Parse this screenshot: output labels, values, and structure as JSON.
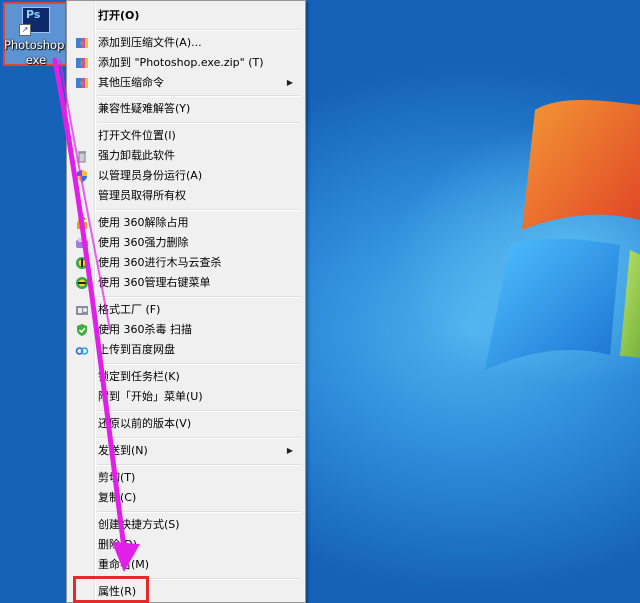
{
  "desktop": {
    "shortcut": {
      "label": "Photoshop.\nexe",
      "icon_text": "Ps"
    }
  },
  "menu": {
    "items": [
      {
        "label": "打开(O)",
        "icon": "none",
        "bold": true
      },
      {
        "label": "添加到压缩文件(A)...",
        "icon": "archive-icon"
      },
      {
        "label": "添加到 \"Photoshop.exe.zip\" (T)",
        "icon": "archive-icon"
      },
      {
        "label": "其他压缩命令",
        "icon": "archive-icon",
        "submenu": true
      },
      {
        "label": "兼容性疑难解答(Y)",
        "icon": "none"
      },
      {
        "label": "打开文件位置(I)",
        "icon": "none"
      },
      {
        "label": "强力卸载此软件",
        "icon": "trash-icon"
      },
      {
        "label": "以管理员身份运行(A)",
        "icon": "shield-icon"
      },
      {
        "label": "管理员取得所有权",
        "icon": "none"
      },
      {
        "label": "使用 360解除占用",
        "icon": "unlock-icon"
      },
      {
        "label": "使用 360强力删除",
        "icon": "shred-icon"
      },
      {
        "label": "使用 360进行木马云查杀",
        "icon": "360-icon"
      },
      {
        "label": "使用 360管理右键菜单",
        "icon": "360-icon"
      },
      {
        "label": "格式工厂 (F)",
        "icon": "format-factory-icon"
      },
      {
        "label": "使用 360杀毒 扫描",
        "icon": "antivirus-icon"
      },
      {
        "label": "上传到百度网盘",
        "icon": "baidu-cloud-icon"
      },
      {
        "label": "锁定到任务栏(K)",
        "icon": "none"
      },
      {
        "label": "附到「开始」菜单(U)",
        "icon": "none"
      },
      {
        "label": "还原以前的版本(V)",
        "icon": "none"
      },
      {
        "label": "发送到(N)",
        "icon": "none",
        "submenu": true
      },
      {
        "label": "剪切(T)",
        "icon": "none"
      },
      {
        "label": "复制(C)",
        "icon": "none"
      },
      {
        "label": "创建快捷方式(S)",
        "icon": "none"
      },
      {
        "label": "删除(D)",
        "icon": "none"
      },
      {
        "label": "重命名(M)",
        "icon": "none"
      },
      {
        "label": "属性(R)",
        "icon": "none"
      }
    ],
    "submenu_arrow": "▶"
  },
  "colors": {
    "highlight_box": "#e52a2a",
    "arrow": "#e020e8",
    "desktop_blue": "#1d6fc4"
  }
}
